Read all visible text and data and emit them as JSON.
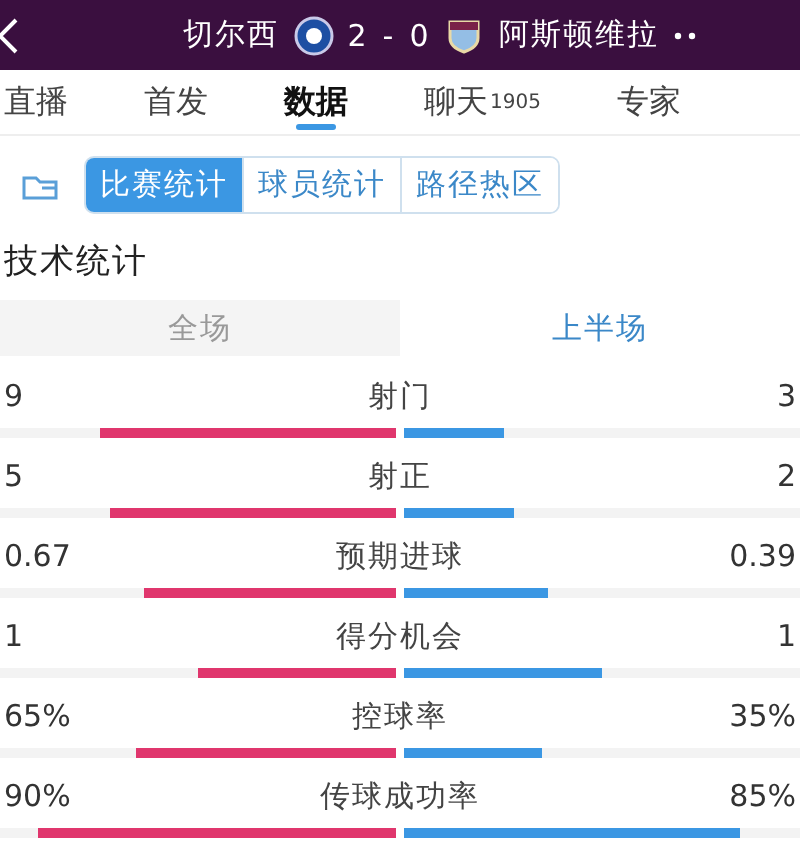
{
  "header": {
    "home_team": "切尔西",
    "score_home": "2",
    "score_separator": "-",
    "score_away": "0",
    "away_team": "阿斯顿维拉"
  },
  "tabs": [
    {
      "label": "直播",
      "selected": false
    },
    {
      "label": "首发",
      "selected": false
    },
    {
      "label": "数据",
      "selected": true
    },
    {
      "label": "聊天",
      "badge": "1905",
      "selected": false
    },
    {
      "label": "专家",
      "selected": false
    }
  ],
  "segments": [
    {
      "label": "比赛统计",
      "selected": true
    },
    {
      "label": "球员统计",
      "selected": false
    },
    {
      "label": "路径热区",
      "selected": false
    }
  ],
  "section_title": "技术统计",
  "period_toggle": [
    {
      "label": "全场",
      "selected": false
    },
    {
      "label": "上半场",
      "selected": true
    }
  ],
  "stats": [
    {
      "name": "射门",
      "home": {
        "value": "9",
        "level": 0.75
      },
      "away": {
        "value": "3",
        "level": 0.25
      }
    },
    {
      "name": "射正",
      "home": {
        "value": "5",
        "level": 0.72
      },
      "away": {
        "value": "2",
        "level": 0.28
      }
    },
    {
      "name": "预期进球",
      "home": {
        "value": "0.67",
        "level": 0.635
      },
      "away": {
        "value": "0.39",
        "level": 0.365
      }
    },
    {
      "name": "得分机会",
      "home": {
        "value": "1",
        "level": 0.5
      },
      "away": {
        "value": "1",
        "level": 0.5
      }
    },
    {
      "name": "控球率",
      "home": {
        "value": "65%",
        "level": 0.655
      },
      "away": {
        "value": "35%",
        "level": 0.35
      }
    },
    {
      "name": "传球成功率",
      "home": {
        "value": "90%",
        "level": 0.905
      },
      "away": {
        "value": "85%",
        "level": 0.85
      }
    }
  ]
}
